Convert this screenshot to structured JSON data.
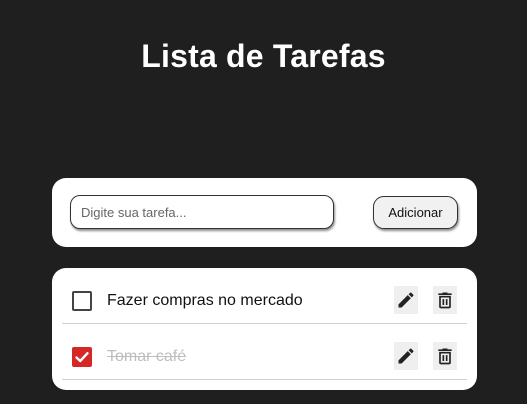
{
  "header": {
    "title": "Lista de Tarefas"
  },
  "form": {
    "input_value": "",
    "input_placeholder": "Digite sua tarefa...",
    "add_label": "Adicionar"
  },
  "tasks": [
    {
      "label": "Fazer compras no mercado",
      "completed": false
    },
    {
      "label": "Tomar café",
      "completed": true
    }
  ],
  "colors": {
    "background": "#1f1f1f",
    "card": "#ffffff",
    "checked": "#d72626",
    "completed_text": "#bdbdbd"
  },
  "icons": {
    "edit": "pencil-icon",
    "delete": "trash-icon",
    "check": "checkmark-icon"
  }
}
